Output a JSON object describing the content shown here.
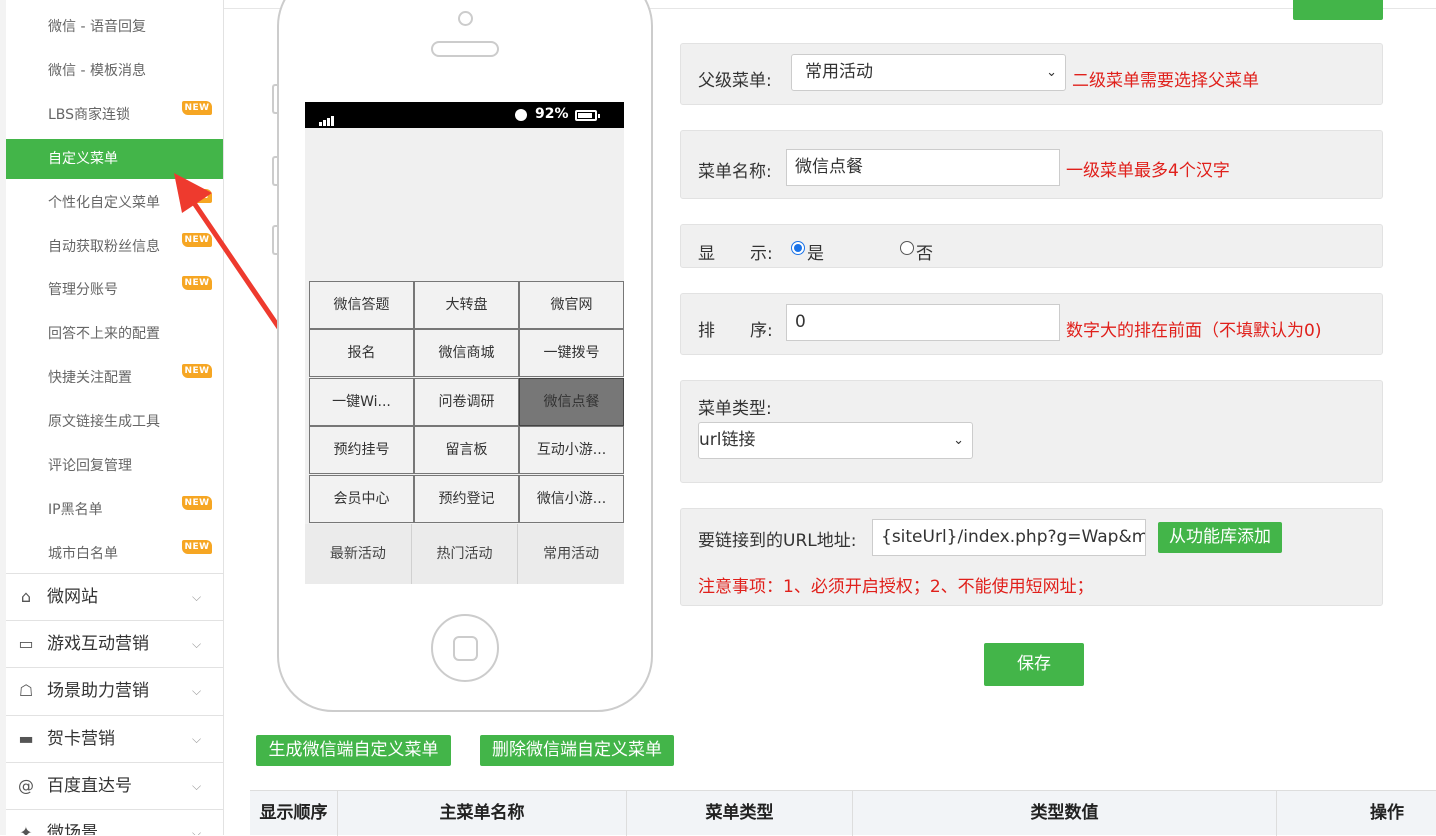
{
  "sidebar": {
    "sub_items": [
      {
        "label": "微信 - 语音回复",
        "new": false,
        "active": false
      },
      {
        "label": "微信 - 模板消息",
        "new": false,
        "active": false
      },
      {
        "label": "LBS商家连锁",
        "new": true,
        "active": false
      },
      {
        "label": "自定义菜单",
        "new": false,
        "active": true
      },
      {
        "label": "个性化自定义菜单",
        "new": true,
        "active": false
      },
      {
        "label": "自动获取粉丝信息",
        "new": true,
        "active": false
      },
      {
        "label": "管理分账号",
        "new": true,
        "active": false
      },
      {
        "label": "回答不上来的配置",
        "new": false,
        "active": false
      },
      {
        "label": "快捷关注配置",
        "new": true,
        "active": false
      },
      {
        "label": "原文链接生成工具",
        "new": false,
        "active": false
      },
      {
        "label": "评论回复管理",
        "new": false,
        "active": false
      },
      {
        "label": "IP黑名单",
        "new": true,
        "active": false
      },
      {
        "label": "城市白名单",
        "new": true,
        "active": false
      }
    ],
    "new_badge": "NEW",
    "categories": [
      {
        "label": "微网站",
        "icon": "home-icon"
      },
      {
        "label": "游戏互动营销",
        "icon": "gamepad-icon"
      },
      {
        "label": "场景助力营销",
        "icon": "bank-icon"
      },
      {
        "label": "贺卡营销",
        "icon": "card-icon"
      },
      {
        "label": "百度直达号",
        "icon": "at-icon"
      },
      {
        "label": "微场景",
        "icon": "scene-icon"
      }
    ]
  },
  "phone": {
    "battery_text": "92%",
    "submenu": [
      "微信答题",
      "大转盘",
      "微官网",
      "报名",
      "微信商城",
      "一键拨号",
      "一键Wi...",
      "问卷调研",
      "微信点餐",
      "预约挂号",
      "留言板",
      "互动小游...",
      "会员中心",
      "预约登记",
      "微信小游..."
    ],
    "selected_submenu": "微信点餐",
    "main_menu": [
      "最新活动",
      "热门活动",
      "常用活动"
    ]
  },
  "form": {
    "parent_label": "父级菜单:",
    "parent_value": "常用活动",
    "parent_hint": "二级菜单需要选择父菜单",
    "name_label": "菜单名称:",
    "name_value": "微信点餐",
    "name_hint": "一级菜单最多4个汉字",
    "display_label_1": "显",
    "display_label_2": "示:",
    "display_yes": "是",
    "display_no": "否",
    "order_label_1": "排",
    "order_label_2": "序:",
    "order_value": "0",
    "order_hint": "数字大的排在前面（不填默认为0)",
    "type_label": "菜单类型:",
    "type_value": "url链接",
    "url_label": "要链接到的URL地址:",
    "url_value": "{siteUrl}/index.php?g=Wap&m=In",
    "url_button": "从功能库添加",
    "url_note": "注意事项：1、必须开启授权；2、不能使用短网址；",
    "save_button": "保存"
  },
  "actions": {
    "generate": "生成微信端自定义菜单",
    "delete": "删除微信端自定义菜单"
  },
  "table": {
    "headers": [
      "显示顺序",
      "主菜单名称",
      "菜单类型",
      "类型数值",
      "操作"
    ]
  },
  "colors": {
    "accent_green": "#43b549",
    "hint_red": "#e0201b",
    "badge_orange": "#f6a623"
  }
}
